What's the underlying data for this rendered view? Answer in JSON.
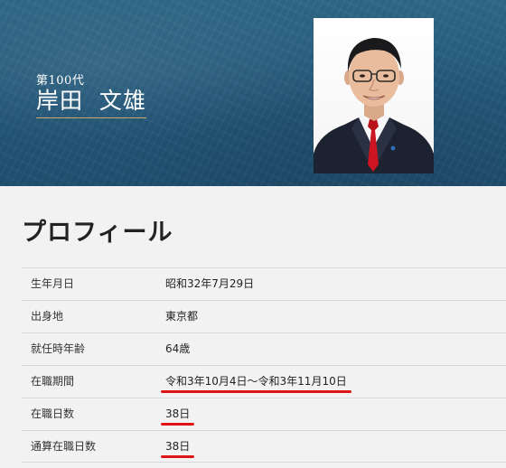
{
  "header": {
    "generation": "第100代",
    "name": "岸田  文雄"
  },
  "portrait": {
    "alt_subject": "Fumio Kishida"
  },
  "profile": {
    "title": "プロフィール",
    "rows": [
      {
        "label": "生年月日",
        "value": "昭和32年7月29日",
        "underlined": false
      },
      {
        "label": "出身地",
        "value": "東京都",
        "underlined": false
      },
      {
        "label": "就任時年齢",
        "value": "64歳",
        "underlined": false
      },
      {
        "label": "在職期間",
        "value": "令和3年10月4日～令和3年11月10日",
        "underlined": true
      },
      {
        "label": "在職日数",
        "value": "38日",
        "underlined": true
      },
      {
        "label": "通算在職日数",
        "value": "38日",
        "underlined": true
      }
    ]
  },
  "colors": {
    "banner": "#24587a",
    "underline": "#e01414",
    "name_rule": "#c9a96a"
  }
}
